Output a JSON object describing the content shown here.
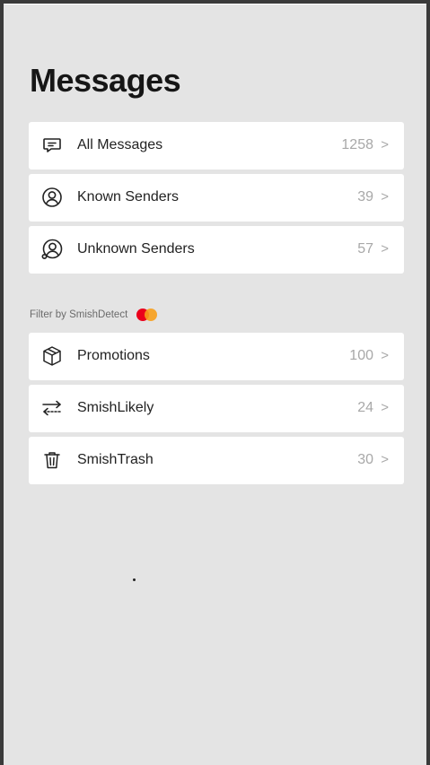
{
  "page": {
    "title": "Messages"
  },
  "groups": {
    "top": [
      {
        "label": "All Messages",
        "count": "1258",
        "icon": "message-icon"
      },
      {
        "label": "Known Senders",
        "count": "39",
        "icon": "user-circle-icon"
      },
      {
        "label": "Unknown Senders",
        "count": "57",
        "icon": "unknown-user-icon"
      }
    ],
    "filtered": [
      {
        "label": "Promotions",
        "count": "100",
        "icon": "box-icon"
      },
      {
        "label": "SmishLikely",
        "count": "24",
        "icon": "swap-arrows-icon"
      },
      {
        "label": "SmishTrash",
        "count": "30",
        "icon": "trash-icon"
      }
    ]
  },
  "filter": {
    "text": "Filter by SmishDetect",
    "logo_icon": "mastercard-logo"
  },
  "chevron": ">",
  "colors": {
    "background": "#e4e4e4",
    "card": "#ffffff",
    "muted": "#a8a8a8"
  }
}
